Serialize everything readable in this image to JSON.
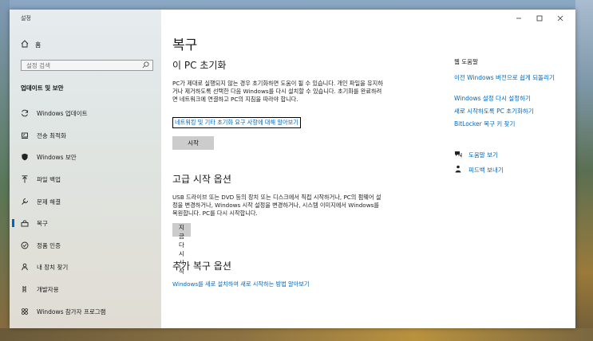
{
  "window": {
    "title": "설정"
  },
  "sidebar": {
    "home_label": "홈",
    "search_placeholder": "설정 검색",
    "section_title": "업데이트 및 보안",
    "items": [
      {
        "label": "Windows 업데이트",
        "icon": "sync-icon"
      },
      {
        "label": "전송 최적화",
        "icon": "delivery-optimization-icon"
      },
      {
        "label": "Windows 보안",
        "icon": "shield-icon"
      },
      {
        "label": "파일 백업",
        "icon": "backup-arrow-icon"
      },
      {
        "label": "문제 해결",
        "icon": "wrench-icon"
      },
      {
        "label": "복구",
        "icon": "recovery-icon"
      },
      {
        "label": "정품 인증",
        "icon": "check-circle-icon"
      },
      {
        "label": "내 장치 찾기",
        "icon": "person-pin-icon"
      },
      {
        "label": "개발자용",
        "icon": "developer-icon"
      },
      {
        "label": "Windows 참가자 프로그램",
        "icon": "insider-icon"
      }
    ],
    "active_index": 5
  },
  "main": {
    "title": "복구",
    "reset": {
      "heading": "이 PC 초기화",
      "description": "PC가 제대로 실행되지 않는 경우 초기화하면 도움이 될 수 있습니다. 개인 파일을 유지하거나 제거하도록 선택한 다음 Windows를 다시 설치할 수 있습니다. 초기화를 완료하려면 네트워크에 연결하고 PC의 지침을 따라야 합니다.",
      "link": "네트워킹 및 기타 초기화 요구 사항에 대해 알아보기",
      "button": "시작"
    },
    "advanced": {
      "heading": "고급 시작 옵션",
      "description": "USB 드라이브 또는 DVD 등의 장치 또는 디스크에서 직접 시작하거나, PC의 펌웨어 설정을 변경하거나, Windows 시작 설정을 변경하거나, 시스템 이미지에서 Windows를 복원합니다. PC를 다시 시작합니다.",
      "button": "지금 다시 시작"
    },
    "more": {
      "heading": "추가 복구 옵션",
      "link": "Windows를 새로 설치하여 새로 시작하는 방법 알아보기"
    }
  },
  "help": {
    "title": "웹 도움말",
    "links": [
      "이전 Windows 버전으로 쉽게 되돌리기",
      "Windows 설정 다시 설정하기",
      "새로 시작하도록 PC 초기화하기",
      "BitLocker 복구 키 찾기"
    ],
    "get_help": "도움말 보기",
    "feedback": "피드백 보내기"
  },
  "colors": {
    "accent": "#0067c0"
  }
}
